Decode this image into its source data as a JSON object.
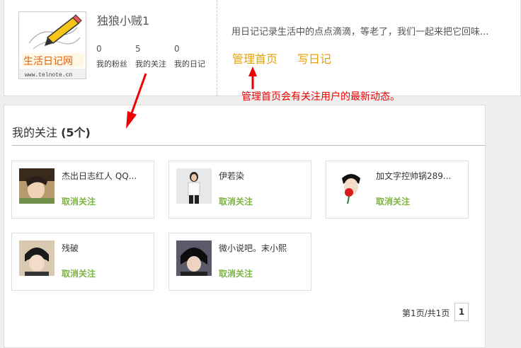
{
  "profile": {
    "username": "独狼小贼1",
    "logo_text": "生活日记网",
    "logo_url": "www.telnote.cn",
    "stats": [
      {
        "value": "0",
        "label": "我的粉丝"
      },
      {
        "value": "5",
        "label": "我的关注"
      },
      {
        "value": "0",
        "label": "我的日记"
      }
    ],
    "description": "用日记记录生活中的点点滴滴，等老了，我们一起来把它回味...",
    "nav": {
      "home": "管理首页",
      "write": "写日记"
    },
    "annotation": "管理首页会有关注用户的最新动态。"
  },
  "following": {
    "title": "我的关注",
    "count": "(5个)",
    "unfollow_label": "取消关注",
    "users": [
      {
        "name": "杰出日志红人 QQ..."
      },
      {
        "name": "伊若染"
      },
      {
        "name": "加文字控帅锅289..."
      },
      {
        "name": "残破"
      },
      {
        "name": "微小说吧。末小熙"
      }
    ],
    "pager": {
      "text": "第1页/共1页",
      "current": "1"
    }
  },
  "colors": {
    "accent_orange": "#e8a000",
    "annotation_red": "#e00000",
    "unfollow_green": "#7cb342"
  }
}
